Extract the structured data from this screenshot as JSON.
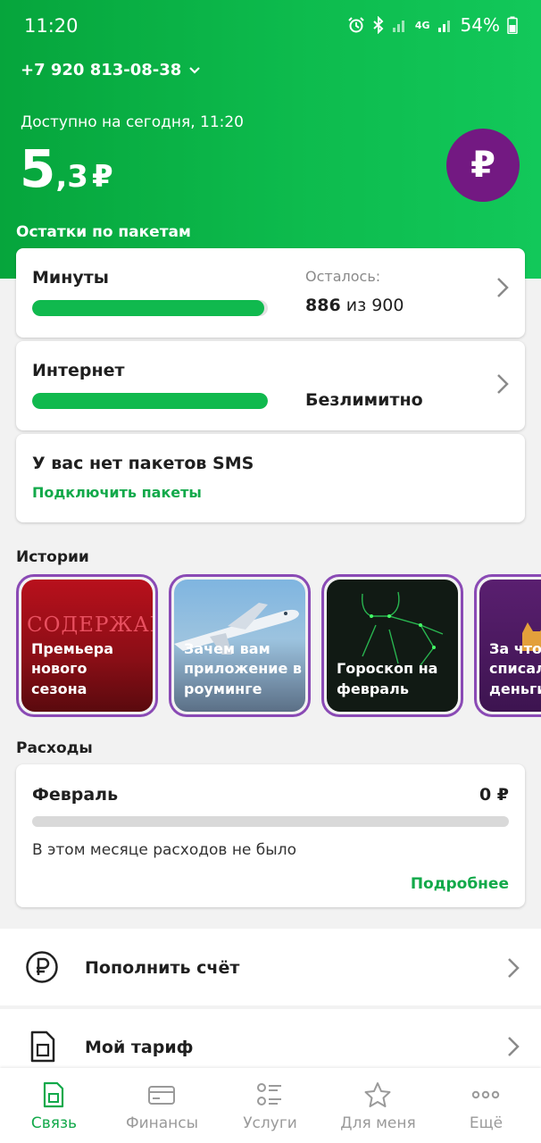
{
  "status_bar": {
    "time": "11:20",
    "network": "4G",
    "battery": "54%"
  },
  "account": {
    "phone": "+7 920 813-08-38"
  },
  "balance": {
    "available_label": "Доступно на сегодня, 11:20",
    "integer": "5",
    "fraction": ",3",
    "currency": "₽",
    "button_symbol": "₽"
  },
  "packages": {
    "section_title": "Остатки по пакетам",
    "minutes": {
      "title": "Минуты",
      "remaining_label": "Осталось:",
      "remaining": "886",
      "of_text": "из 900",
      "fill_fraction": 0.984
    },
    "internet": {
      "title": "Интернет",
      "status": "Безлимитно",
      "fill_fraction": 1.0
    },
    "sms": {
      "title": "У вас нет пакетов SMS",
      "link": "Подключить пакеты"
    }
  },
  "stories": {
    "section_title": "Истории",
    "items": [
      {
        "logo": "СОДЕРЖАНКИ",
        "line1": "Премьера",
        "line2": "нового",
        "line3": "сезона"
      },
      {
        "line1": "Зачем вам",
        "line2": "приложение в",
        "line3": "роуминге"
      },
      {
        "line1": "Гороскоп на",
        "line2": "февраль"
      },
      {
        "line1": "За что",
        "line2": "списал",
        "line3": "деньги"
      }
    ]
  },
  "expenses": {
    "section_title": "Расходы",
    "month": "Февраль",
    "amount": "0 ₽",
    "note": "В этом месяце расходов не было",
    "more": "Подробнее"
  },
  "menu": {
    "top_up": "Пополнить счёт",
    "tariff": "Мой тариф"
  },
  "tabbar": {
    "tabs": [
      {
        "label": "Связь",
        "icon": "sim-icon"
      },
      {
        "label": "Финансы",
        "icon": "card-icon"
      },
      {
        "label": "Услуги",
        "icon": "list-icon"
      },
      {
        "label": "Для меня",
        "icon": "star-icon"
      },
      {
        "label": "Ещё",
        "icon": "more-icon"
      }
    ]
  },
  "colors": {
    "brand_green": "#10b94e",
    "accent_purple": "#731982"
  }
}
